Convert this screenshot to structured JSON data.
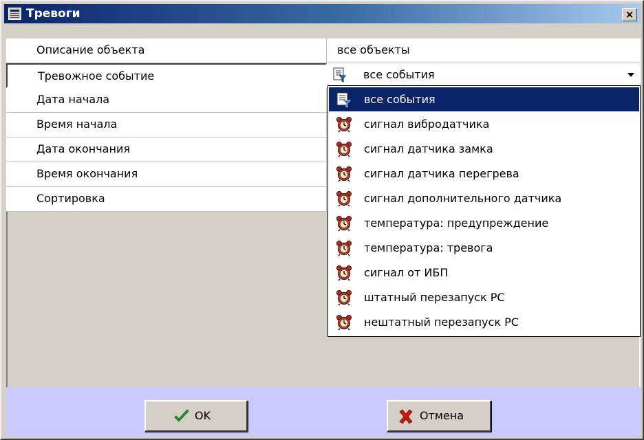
{
  "window": {
    "title": "Тревоги",
    "close_label": "×"
  },
  "fields": [
    {
      "label": "Описание объекта",
      "value": "все объекты"
    },
    {
      "label": "Тревожное событие",
      "value": "все события"
    },
    {
      "label": "Дата начала",
      "value": ""
    },
    {
      "label": "Время начала",
      "value": ""
    },
    {
      "label": "Дата окончания",
      "value": ""
    },
    {
      "label": "Время окончания",
      "value": ""
    },
    {
      "label": "Сортировка",
      "value": ""
    }
  ],
  "dropdown": {
    "selected_index": 0,
    "items": [
      {
        "label": "все события",
        "icon": "filter-list-icon"
      },
      {
        "label": "сигнал вибродатчика",
        "icon": "alarm-clock-icon"
      },
      {
        "label": "сигнал датчика замка",
        "icon": "alarm-clock-icon"
      },
      {
        "label": "сигнал датчика перегрева",
        "icon": "alarm-clock-icon"
      },
      {
        "label": "сигнал дополнительного датчика",
        "icon": "alarm-clock-icon"
      },
      {
        "label": "температура: предупреждение",
        "icon": "alarm-clock-icon"
      },
      {
        "label": "температура: тревога",
        "icon": "alarm-clock-icon"
      },
      {
        "label": "сигнал от ИБП",
        "icon": "alarm-clock-icon"
      },
      {
        "label": "штатный перезапуск РС",
        "icon": "alarm-clock-icon"
      },
      {
        "label": "нештатный перезапуск РС",
        "icon": "alarm-clock-icon"
      }
    ]
  },
  "buttons": {
    "ok_label": "OK",
    "cancel_label": "Отмена"
  },
  "colors": {
    "titlebar": "#0a246a",
    "selection": "#0a246a",
    "button_bar": "#c9c9ff",
    "ok_check": "#2a9a1a",
    "cancel_x": "#cc1a0a"
  }
}
